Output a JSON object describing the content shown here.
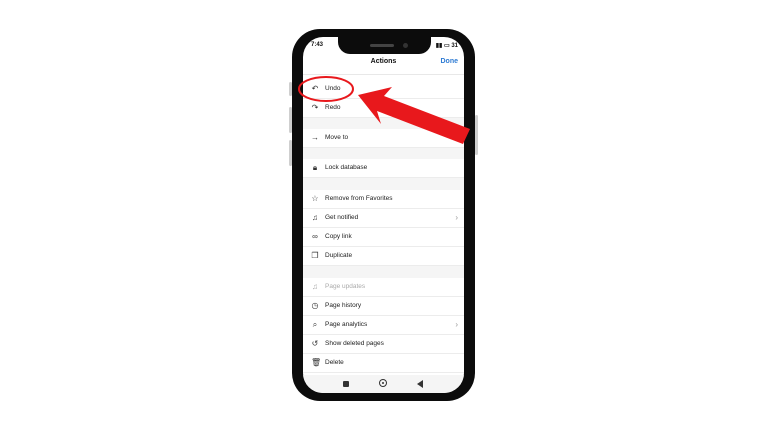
{
  "status": {
    "time": "7:43",
    "battery": "31"
  },
  "header": {
    "title": "Actions",
    "done_label": "Done"
  },
  "menu": {
    "undo": "Undo",
    "redo": "Redo",
    "move_to": "Move to",
    "lock_database": "Lock database",
    "remove_favorites": "Remove from Favorites",
    "get_notified": "Get notified",
    "copy_link": "Copy link",
    "duplicate": "Duplicate",
    "page_updates": "Page updates",
    "page_history": "Page history",
    "page_analytics": "Page analytics",
    "show_deleted": "Show deleted pages",
    "delete": "Delete"
  },
  "colors": {
    "accent": "#2e7bd3",
    "annotation": "#e8181c"
  }
}
